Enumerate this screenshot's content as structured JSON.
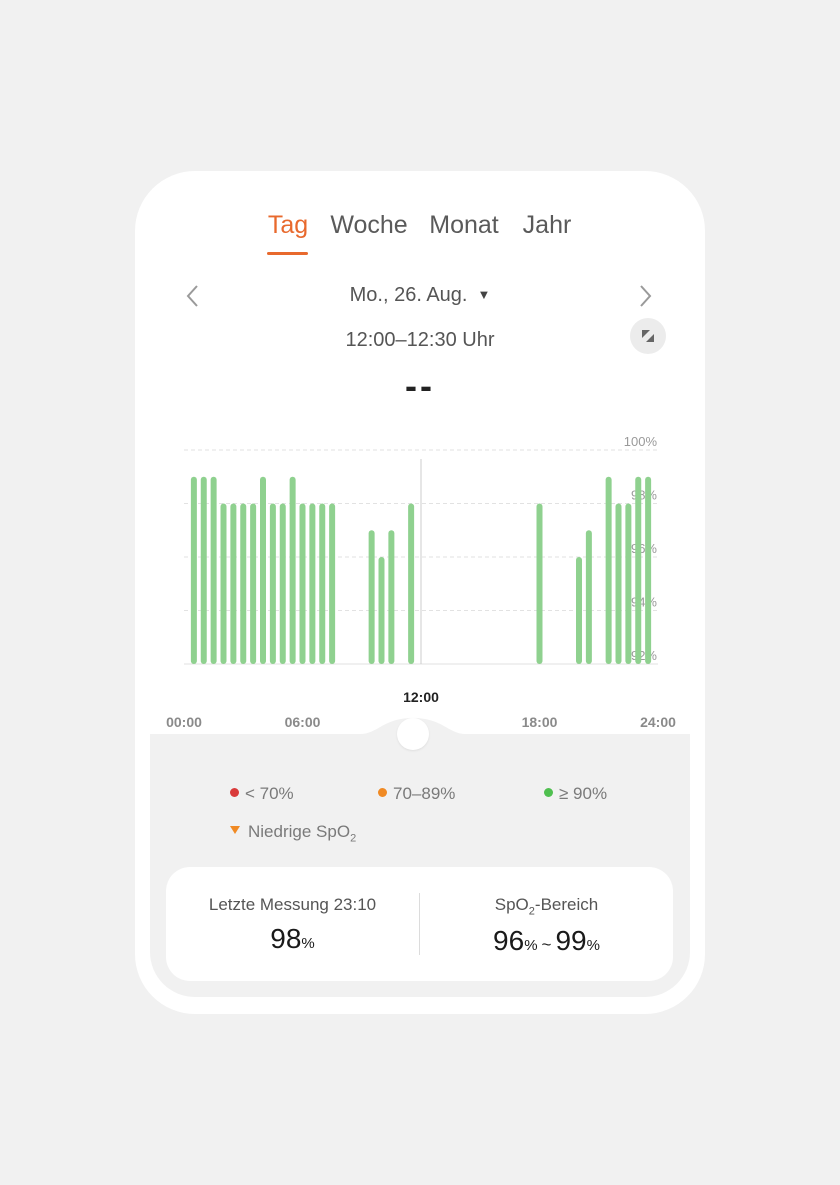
{
  "tabs": [
    {
      "label": "Tag",
      "active": true
    },
    {
      "label": "Woche",
      "active": false
    },
    {
      "label": "Monat",
      "active": false
    },
    {
      "label": "Jahr",
      "active": false
    }
  ],
  "date_selector": {
    "label": "Mo., 26. Aug."
  },
  "time_range": "12:00–12:30 Uhr",
  "current_value": "--",
  "colors": {
    "accent": "#e8692d",
    "bar_green": "#8fd18f",
    "legend_red": "#d93a3a",
    "legend_orange": "#f08a24",
    "legend_green": "#4fbf4f"
  },
  "chart_data": {
    "type": "bar",
    "x_range": [
      "00:00",
      "24:00"
    ],
    "x_tick_labels": [
      "00:00",
      "06:00",
      "18:00",
      "24:00"
    ],
    "ylim": [
      92,
      100
    ],
    "y_tick_labels": [
      "100%",
      "98%",
      "96%",
      "94%",
      "92%"
    ],
    "grid": true,
    "bars": [
      {
        "x": "00:30",
        "value": 99
      },
      {
        "x": "01:00",
        "value": 99
      },
      {
        "x": "01:30",
        "value": 99
      },
      {
        "x": "02:00",
        "value": 98
      },
      {
        "x": "02:30",
        "value": 98
      },
      {
        "x": "03:00",
        "value": 98
      },
      {
        "x": "03:30",
        "value": 98
      },
      {
        "x": "04:00",
        "value": 99
      },
      {
        "x": "04:30",
        "value": 98
      },
      {
        "x": "05:00",
        "value": 98
      },
      {
        "x": "05:30",
        "value": 99
      },
      {
        "x": "06:00",
        "value": 98
      },
      {
        "x": "06:30",
        "value": 98
      },
      {
        "x": "07:00",
        "value": 98
      },
      {
        "x": "07:30",
        "value": 98
      },
      {
        "x": "09:30",
        "value": 97
      },
      {
        "x": "10:00",
        "value": 96
      },
      {
        "x": "10:30",
        "value": 97
      },
      {
        "x": "11:30",
        "value": 98
      },
      {
        "x": "18:00",
        "value": 98
      },
      {
        "x": "20:00",
        "value": 96
      },
      {
        "x": "20:30",
        "value": 97
      },
      {
        "x": "21:30",
        "value": 99
      },
      {
        "x": "22:00",
        "value": 98
      },
      {
        "x": "22:30",
        "value": 98
      },
      {
        "x": "23:00",
        "value": 99
      },
      {
        "x": "23:30",
        "value": 99
      }
    ],
    "selected_time": "12:00"
  },
  "legend": {
    "items": [
      {
        "label": "< 70%",
        "color": "#d93a3a"
      },
      {
        "label": "70–89%",
        "color": "#f08a24"
      },
      {
        "label": "≥ 90%",
        "color": "#4fbf4f"
      }
    ],
    "low_spo2_label": "Niedrige SpO",
    "low_spo2_sub": "2"
  },
  "stats": {
    "last_measurement_label": "Letzte Messung 23:10",
    "last_measurement_value": "98",
    "unit": "%",
    "range_label": "SpO",
    "range_label_sub": "2",
    "range_label_suffix": "-Bereich",
    "range_min": "96",
    "range_max": "99",
    "range_separator": "~"
  },
  "icons": {
    "prev": "chevron-left-icon",
    "next": "chevron-right-icon",
    "dropdown": "caret-down-icon",
    "expand": "expand-icon",
    "scrubber": "scrubber-handle"
  }
}
